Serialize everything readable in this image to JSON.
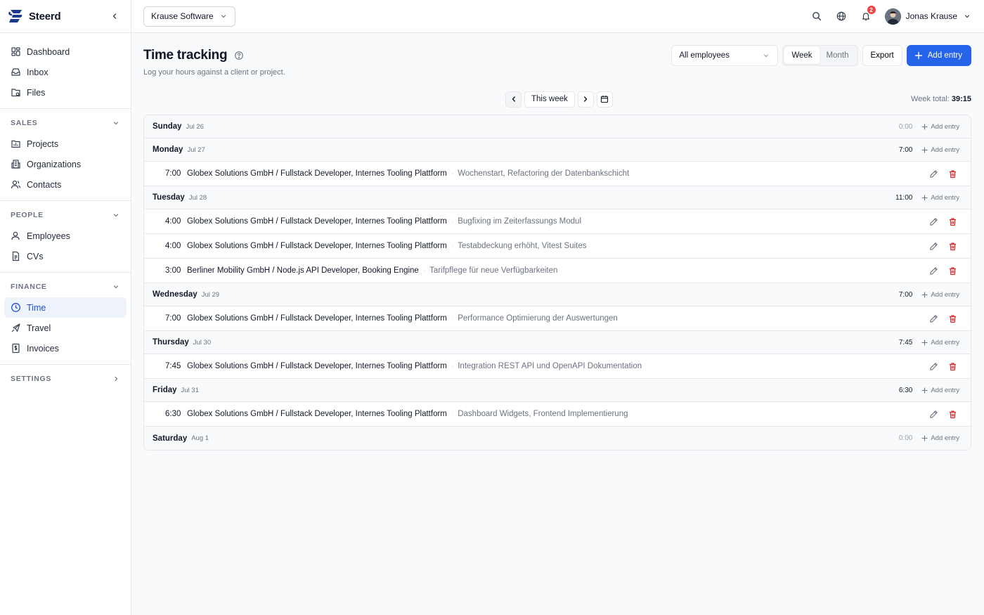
{
  "brand": {
    "name": "Steerd",
    "color": "#1e3a8a"
  },
  "sidebar": {
    "top_items": [
      {
        "label": "Dashboard",
        "icon": "dashboard-icon"
      },
      {
        "label": "Inbox",
        "icon": "inbox-icon"
      },
      {
        "label": "Files",
        "icon": "files-icon"
      }
    ],
    "sections": [
      {
        "label": "SALES",
        "items": [
          {
            "label": "Projects"
          },
          {
            "label": "Organizations"
          },
          {
            "label": "Contacts"
          }
        ]
      },
      {
        "label": "PEOPLE",
        "items": [
          {
            "label": "Employees"
          },
          {
            "label": "CVs"
          }
        ]
      },
      {
        "label": "FINANCE",
        "items": [
          {
            "label": "Time",
            "active": true
          },
          {
            "label": "Travel"
          },
          {
            "label": "Invoices"
          }
        ]
      },
      {
        "label": "SETTINGS",
        "items": []
      }
    ]
  },
  "topbar": {
    "workspace": "Krause Software",
    "notifications": "2",
    "user_name": "Jonas Krause"
  },
  "page": {
    "title": "Time tracking",
    "subtitle": "Log your hours against a client or project.",
    "filter_value": "All employees",
    "view_week": "Week",
    "view_month": "Month",
    "export_label": "Export",
    "add_label": "Add entry"
  },
  "week_nav": {
    "label": "This week",
    "total_label": "Week total:",
    "total_value": "39:15"
  },
  "day_add_label": "Add entry",
  "days": [
    {
      "name": "Sunday",
      "date": "Jul 26",
      "total": "0:00",
      "entries": []
    },
    {
      "name": "Monday",
      "date": "Jul 27",
      "total": "7:00",
      "entries": [
        {
          "duration": "7:00",
          "project": "Globex Solutions GmbH / Fullstack Developer, Internes Tooling Plattform",
          "note": "Wochenstart, Refactoring der Datenbankschicht"
        }
      ]
    },
    {
      "name": "Tuesday",
      "date": "Jul 28",
      "total": "11:00",
      "entries": [
        {
          "duration": "4:00",
          "project": "Globex Solutions GmbH / Fullstack Developer, Internes Tooling Plattform",
          "note": "Bugfixing im Zeiterfassungs Modul"
        },
        {
          "duration": "4:00",
          "project": "Globex Solutions GmbH / Fullstack Developer, Internes Tooling Plattform",
          "note": "Testabdeckung erhöht, Vitest Suites"
        },
        {
          "duration": "3:00",
          "project": "Berliner Mobility GmbH / Node.js API Developer, Booking Engine",
          "note": "Tarifpflege für neue Verfügbarkeiten"
        }
      ]
    },
    {
      "name": "Wednesday",
      "date": "Jul 29",
      "total": "7:00",
      "entries": [
        {
          "duration": "7:00",
          "project": "Globex Solutions GmbH / Fullstack Developer, Internes Tooling Plattform",
          "note": "Performance Optimierung der Auswertungen"
        }
      ]
    },
    {
      "name": "Thursday",
      "date": "Jul 30",
      "total": "7:45",
      "entries": [
        {
          "duration": "7:45",
          "project": "Globex Solutions GmbH / Fullstack Developer, Internes Tooling Plattform",
          "note": "Integration REST API und OpenAPI Dokumentation"
        }
      ]
    },
    {
      "name": "Friday",
      "date": "Jul 31",
      "total": "6:30",
      "entries": [
        {
          "duration": "6:30",
          "project": "Globex Solutions GmbH / Fullstack Developer, Internes Tooling Plattform",
          "note": "Dashboard Widgets, Frontend Implementierung"
        }
      ]
    },
    {
      "name": "Saturday",
      "date": "Aug 1",
      "total": "0:00",
      "entries": []
    }
  ]
}
